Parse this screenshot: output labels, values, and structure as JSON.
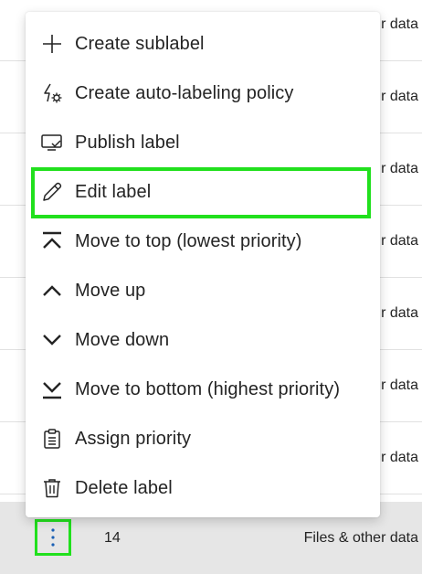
{
  "background_rows": [
    {
      "category": "r data"
    },
    {
      "category": "r data"
    },
    {
      "category": "r data"
    },
    {
      "category": "r data"
    },
    {
      "category": "r data"
    },
    {
      "category": "r data"
    },
    {
      "category": "r data"
    }
  ],
  "selected_row": {
    "priority": "14",
    "category": "Files & other data"
  },
  "menu": {
    "items": [
      {
        "label": "Create sublabel",
        "icon": "plus-icon"
      },
      {
        "label": "Create auto-labeling policy",
        "icon": "auto-label-icon"
      },
      {
        "label": "Publish label",
        "icon": "publish-icon"
      },
      {
        "label": "Edit label",
        "icon": "pencil-icon"
      },
      {
        "label": "Move to top (lowest priority)",
        "icon": "move-top-icon"
      },
      {
        "label": "Move up",
        "icon": "chevron-up-icon"
      },
      {
        "label": "Move down",
        "icon": "chevron-down-icon"
      },
      {
        "label": "Move to bottom (highest priority)",
        "icon": "move-bottom-icon"
      },
      {
        "label": "Assign priority",
        "icon": "clipboard-icon"
      },
      {
        "label": "Delete label",
        "icon": "trash-icon"
      }
    ],
    "highlighted_item": "Edit label"
  },
  "colors": {
    "highlight": "#21e01d",
    "selected_row_bg": "#e6e6e6",
    "text": "#242424"
  }
}
